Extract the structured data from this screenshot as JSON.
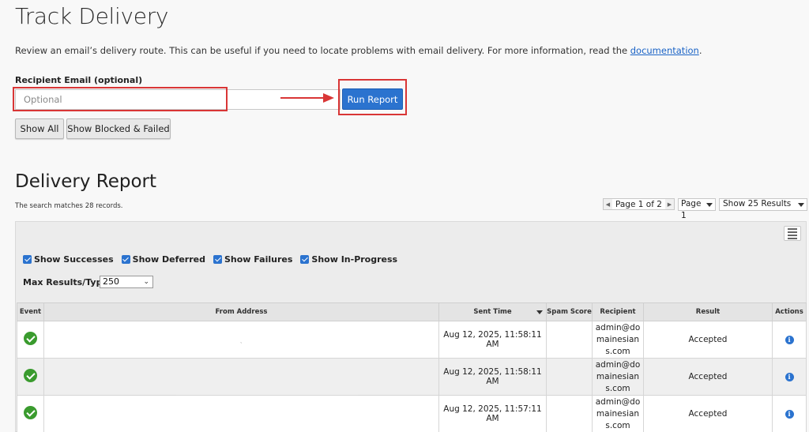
{
  "header": {
    "title": "Track Delivery",
    "description_prefix": "Review an email’s delivery route. This can be useful if you need to locate problems with email delivery. For more information, read the ",
    "documentation_link": "documentation",
    "description_suffix": "."
  },
  "form": {
    "recipient_label": "Recipient Email (optional)",
    "recipient_placeholder": "Optional",
    "recipient_value": "",
    "run_report_label": "Run Report",
    "show_all_label": "Show All",
    "show_blocked_label": "Show Blocked & Failed",
    "highlight_color": "#d93636"
  },
  "report": {
    "title": "Delivery Report",
    "match_text": "The search matches 28 records.",
    "pager": {
      "label": "Page 1 of 2",
      "current_page": 1,
      "total_pages": 2
    },
    "page_select": {
      "label": "Page",
      "value": "1"
    },
    "results_select": {
      "value": "Show 25 Results"
    },
    "filters": [
      {
        "label": "Show Successes",
        "checked": true
      },
      {
        "label": "Show Deferred",
        "checked": true
      },
      {
        "label": "Show Failures",
        "checked": true
      },
      {
        "label": "Show In-Progress",
        "checked": true
      }
    ],
    "max_results_label": "Max Results/Type:",
    "max_results_value": "250",
    "columns": [
      "Event",
      "From Address",
      "Sent Time",
      "Spam Score",
      "Recipient",
      "Result",
      "Actions"
    ],
    "rows": [
      {
        "event": "success-icon",
        "from": "ˎ",
        "sent_time": "Aug 12, 2025, 11:58:11 AM",
        "spam_score": "",
        "recipient": "admin@domainesians.com",
        "result": "Accepted",
        "action": "info-icon"
      },
      {
        "event": "success-icon",
        "from": "",
        "sent_time": "Aug 12, 2025, 11:58:11 AM",
        "spam_score": "",
        "recipient": "admin@domainesians.com",
        "result": "Accepted",
        "action": "info-icon"
      },
      {
        "event": "success-icon",
        "from": "",
        "sent_time": "Aug 12, 2025, 11:57:11 AM",
        "spam_score": "",
        "recipient": "admin@domainesians.com",
        "result": "Accepted",
        "action": "info-icon"
      }
    ]
  },
  "colors": {
    "primary": "#2b73cf",
    "success": "#3a9b2e",
    "annotation": "#d93636"
  }
}
